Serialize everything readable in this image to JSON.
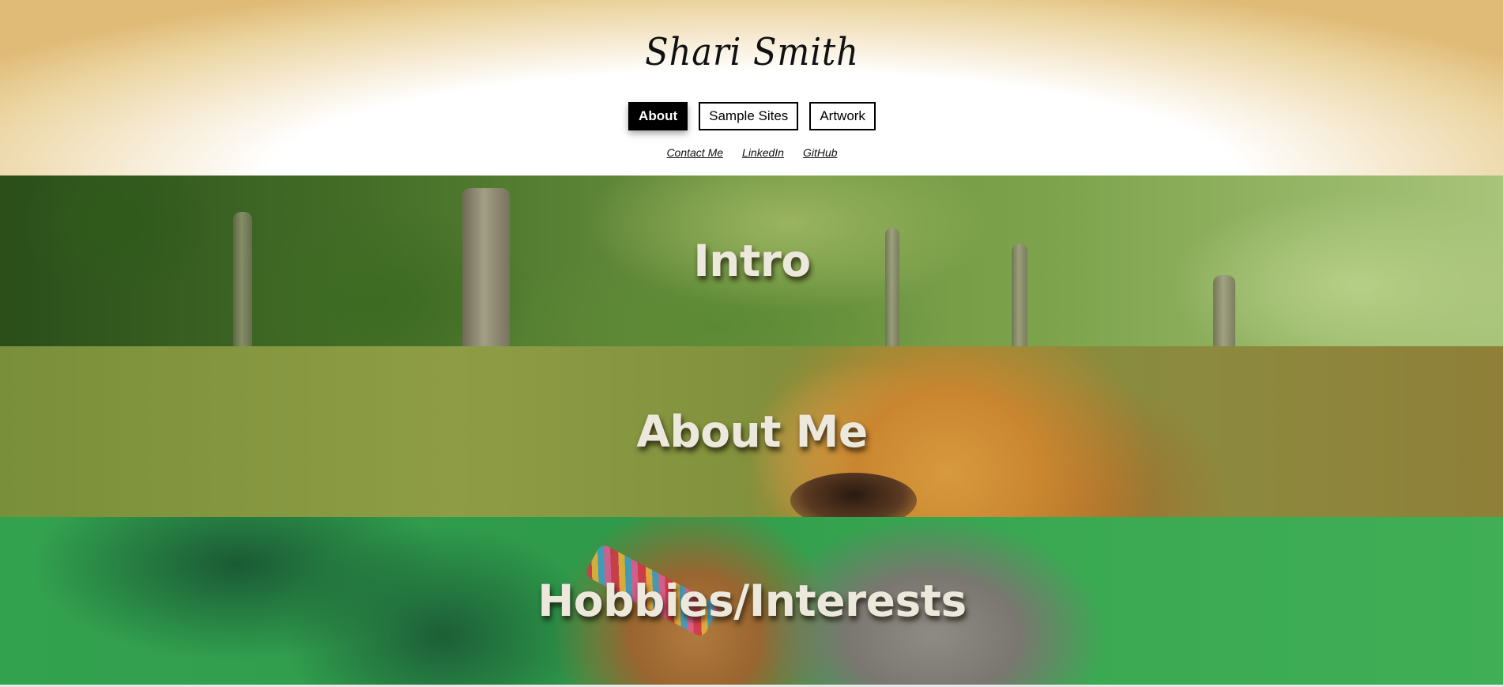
{
  "header": {
    "site_title": "Shari Smith",
    "nav": {
      "about": "About",
      "sample_sites": "Sample Sites",
      "artwork": "Artwork"
    },
    "links": {
      "contact": "Contact Me",
      "linkedin": "LinkedIn",
      "github": "GitHub"
    }
  },
  "sections": {
    "intro": "Intro",
    "about_me": "About Me",
    "hobbies": "Hobbies/Interests"
  },
  "colors": {
    "header_gold": "#e0bb77",
    "active_nav_bg": "#000000",
    "section_title": "#ece8dc"
  }
}
